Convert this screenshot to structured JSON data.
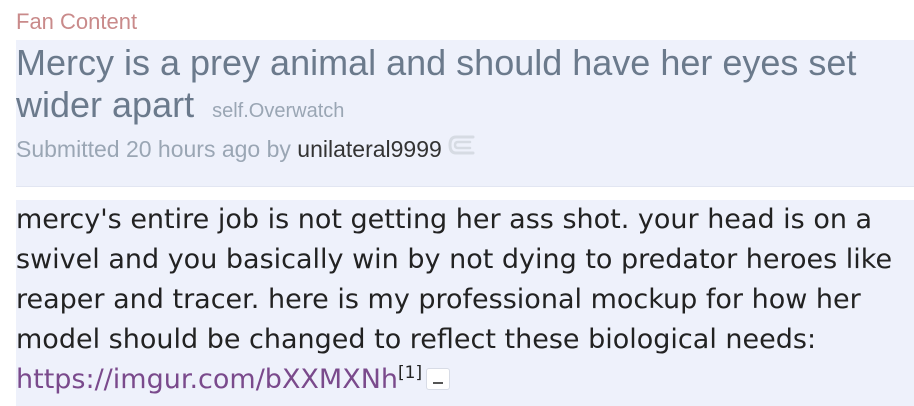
{
  "post": {
    "flair": "Fan Content",
    "title": "Mercy is a prey animal and should have her eyes set wider apart",
    "domain": "self.Overwatch",
    "submitted_prefix": "Submitted 20 hours ago by",
    "author": "unilateral9999",
    "body_text": "mercy's entire job is not getting her ass shot. your head is on a swivel and you basically win by not dying to predator heroes like reaper and tracer. here is my professional mockup for how her model should be changed to reflect these biological needs: ",
    "link_text": "https://imgur.com/bXXMXNh",
    "footnote": "[1]"
  },
  "icons": {
    "share": "share-icon",
    "collapse": "collapse-icon"
  },
  "colors": {
    "flair": "#c98a8a",
    "title": "#6b7a8c",
    "meta": "#9aa6b4",
    "link": "#7a4a8c",
    "background": "#eef1fb"
  }
}
